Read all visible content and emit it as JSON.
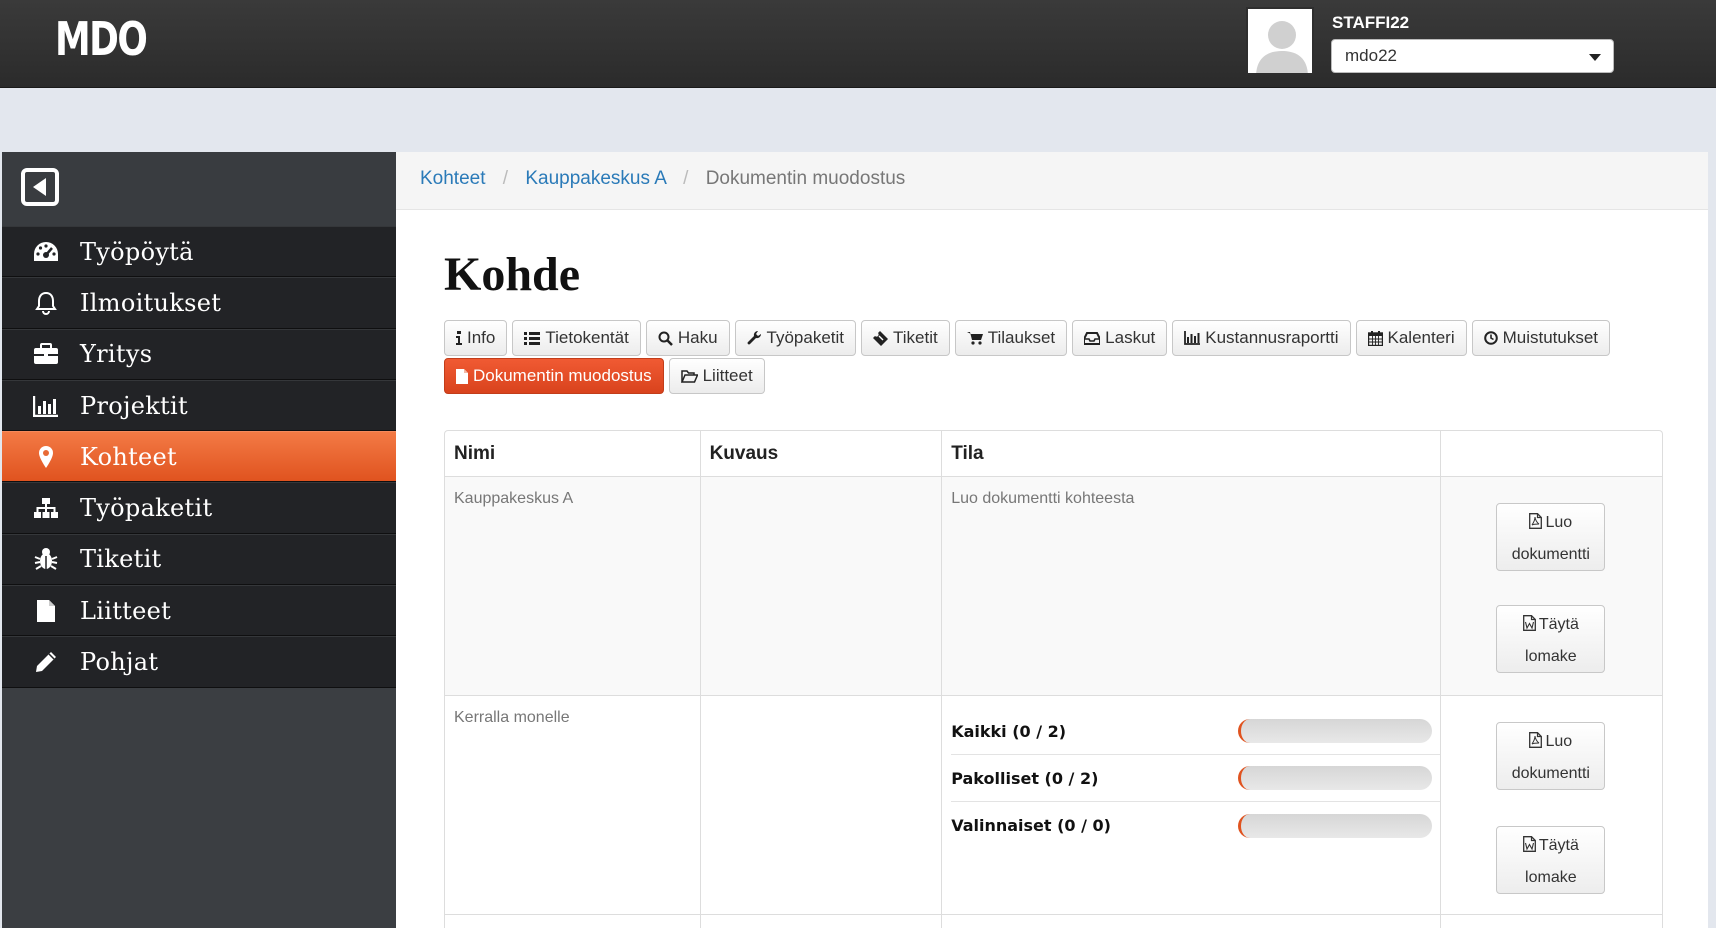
{
  "app": {
    "logo": "MDO"
  },
  "user": {
    "name": "STAFFI22",
    "selected": "mdo22"
  },
  "sidebar": {
    "items": [
      {
        "label": "Työpöytä",
        "icon": "dashboard-icon"
      },
      {
        "label": "Ilmoitukset",
        "icon": "bell-icon"
      },
      {
        "label": "Yritys",
        "icon": "briefcase-icon"
      },
      {
        "label": "Projektit",
        "icon": "bar-chart-icon"
      },
      {
        "label": "Kohteet",
        "icon": "map-marker-icon",
        "active": true
      },
      {
        "label": "Työpaketit",
        "icon": "sitemap-icon"
      },
      {
        "label": "Tiketit",
        "icon": "bug-icon"
      },
      {
        "label": "Liitteet",
        "icon": "file-icon"
      },
      {
        "label": "Pohjat",
        "icon": "pencil-icon"
      }
    ]
  },
  "breadcrumb": {
    "items": [
      "Kohteet",
      "Kauppakeskus A"
    ],
    "current": "Dokumentin muodostus"
  },
  "page": {
    "title": "Kohde"
  },
  "tabs": [
    {
      "label": "Info",
      "icon": "info-icon"
    },
    {
      "label": "Tietokentät",
      "icon": "list-icon"
    },
    {
      "label": "Haku",
      "icon": "search-icon"
    },
    {
      "label": "Työpaketit",
      "icon": "wrench-icon"
    },
    {
      "label": "Tiketit",
      "icon": "ticket-icon"
    },
    {
      "label": "Tilaukset",
      "icon": "cart-icon"
    },
    {
      "label": "Laskut",
      "icon": "inbox-icon"
    },
    {
      "label": "Kustannusraportti",
      "icon": "bar-chart-icon"
    },
    {
      "label": "Kalenteri",
      "icon": "calendar-icon"
    },
    {
      "label": "Muistutukset",
      "icon": "clock-icon"
    },
    {
      "label": "Dokumentin muodostus",
      "icon": "file-icon",
      "active": true
    },
    {
      "label": "Liitteet",
      "icon": "folder-open-icon"
    }
  ],
  "table": {
    "headers": [
      "Nimi",
      "Kuvaus",
      "Tila",
      ""
    ],
    "rows": [
      {
        "name": "Kauppakeskus A",
        "description": "",
        "status": "Luo dokumentti kohteesta",
        "actions": [
          {
            "line1": "Luo",
            "line2": "dokumentti"
          },
          {
            "line1": "Täytä",
            "line2": "lomake"
          }
        ]
      },
      {
        "name": "Kerralla monelle",
        "description": "",
        "progress": [
          {
            "label": "Kaikki (0 / 2)",
            "value": 0
          },
          {
            "label": "Pakolliset (0 / 2)",
            "value": 0
          },
          {
            "label": "Valinnaiset (0 / 0)",
            "value": 0
          }
        ],
        "actions": [
          {
            "line1": "Luo",
            "line2": "dokumentti"
          },
          {
            "line1": "Täytä",
            "line2": "lomake"
          }
        ]
      }
    ]
  },
  "colors": {
    "accent": "#e0531f",
    "link": "#2a7ab8",
    "topbar": "#2f2f2f",
    "sidebar": "#222326"
  }
}
